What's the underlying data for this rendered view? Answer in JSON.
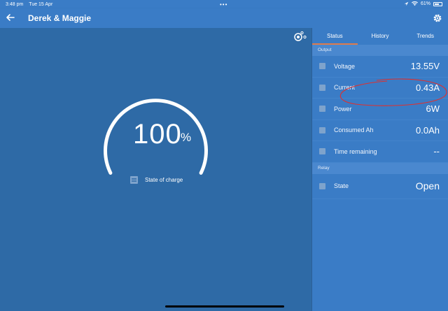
{
  "status_bar": {
    "time": "3:48 pm",
    "date": "Tue 15 Apr",
    "dots": "•••",
    "battery": "61%"
  },
  "header": {
    "title": "Derek & Maggie"
  },
  "gauge": {
    "value": "100",
    "unit": "%",
    "label": "State of charge",
    "fill": 1.0
  },
  "tabs": [
    {
      "label": "Status",
      "active": true
    },
    {
      "label": "History",
      "active": false
    },
    {
      "label": "Trends",
      "active": false
    }
  ],
  "output": {
    "title": "Output",
    "rows": [
      {
        "label": "Voltage",
        "value": "13.55V"
      },
      {
        "label": "Current",
        "value": "0.43A"
      },
      {
        "label": "Power",
        "value": "6W"
      },
      {
        "label": "Consumed Ah",
        "value": "0.0Ah"
      },
      {
        "label": "Time remaining",
        "value": "--"
      }
    ]
  },
  "relay": {
    "title": "Relay",
    "rows": [
      {
        "label": "State",
        "value": "Open"
      }
    ]
  },
  "colors": {
    "header": "#3a7cc6",
    "background": "#2e6aa6",
    "tab_underline": "#e07b4a",
    "annotation": "#e0302e"
  }
}
